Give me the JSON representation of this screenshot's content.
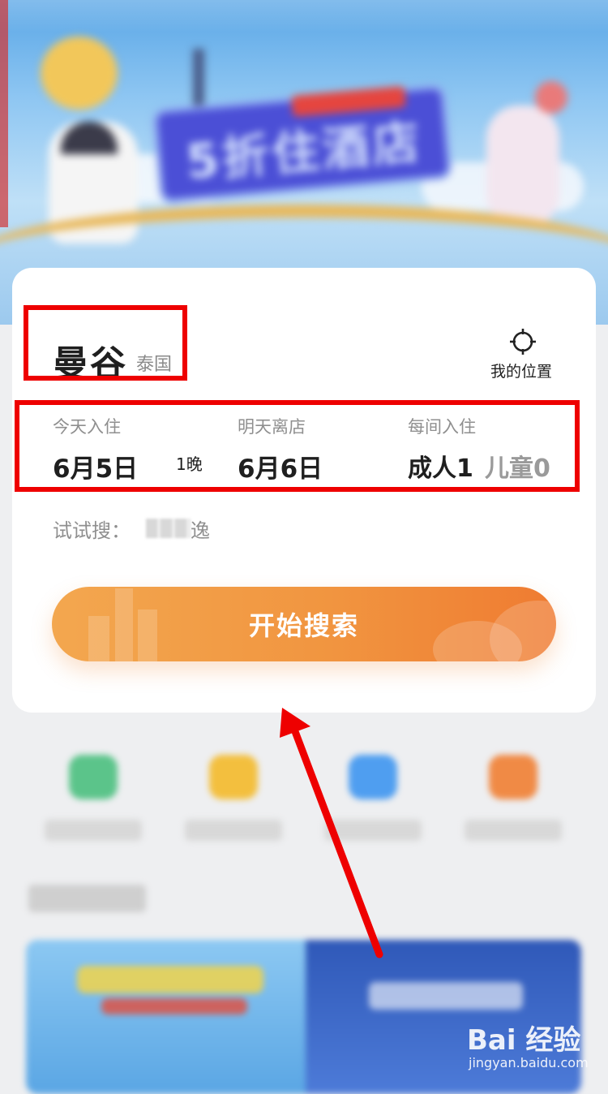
{
  "banner": {
    "sign_text": "5折住酒店"
  },
  "search_card": {
    "city": "曼谷",
    "country": "泰国",
    "my_location_label": "我的位置",
    "checkin_label": "今天入住",
    "checkin_date": "6月5日",
    "nights": "1晚",
    "checkout_label": "明天离店",
    "checkout_date": "6月6日",
    "occupancy_label": "每间入住",
    "adults": "成人1",
    "children": "儿童0",
    "try_search_label": "试试搜：",
    "try_search_suffix": "逸",
    "search_button_label": "开始搜索"
  },
  "watermark": {
    "main": "Bai 经验",
    "sub": "jingyan.baidu.com"
  },
  "colors": {
    "accent_orange": "#f19540",
    "annotation_red": "#ee0000"
  },
  "icons": {
    "location": "crosshair-icon"
  }
}
